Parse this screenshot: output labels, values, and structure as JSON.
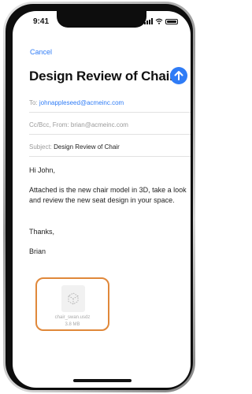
{
  "status_bar": {
    "time": "9:41"
  },
  "compose": {
    "cancel_label": "Cancel",
    "subject_title": "Design Review of Chair",
    "to_label": "To:",
    "to_value": "johnappleseed@acmeinc.com",
    "cc_from_label": "Cc/Bcc, From:",
    "cc_from_value": "brian@acmeinc.com",
    "subject_label": "Subject:",
    "subject_value": "Design Review of Chair"
  },
  "body": {
    "greeting": "Hi John,",
    "paragraph": "Attached is the new chair model in 3D, take a look and review the new seat design in your space.",
    "closing": "Thanks,",
    "signature": "Brian"
  },
  "attachment": {
    "file_name": "chair_swan.usdz",
    "file_size": "3.8 MB",
    "highlight_color": "#e0883a"
  },
  "colors": {
    "accent": "#2f7cf6"
  },
  "icons": {
    "send": "arrow-up-icon",
    "file": "ar-cube-icon"
  }
}
